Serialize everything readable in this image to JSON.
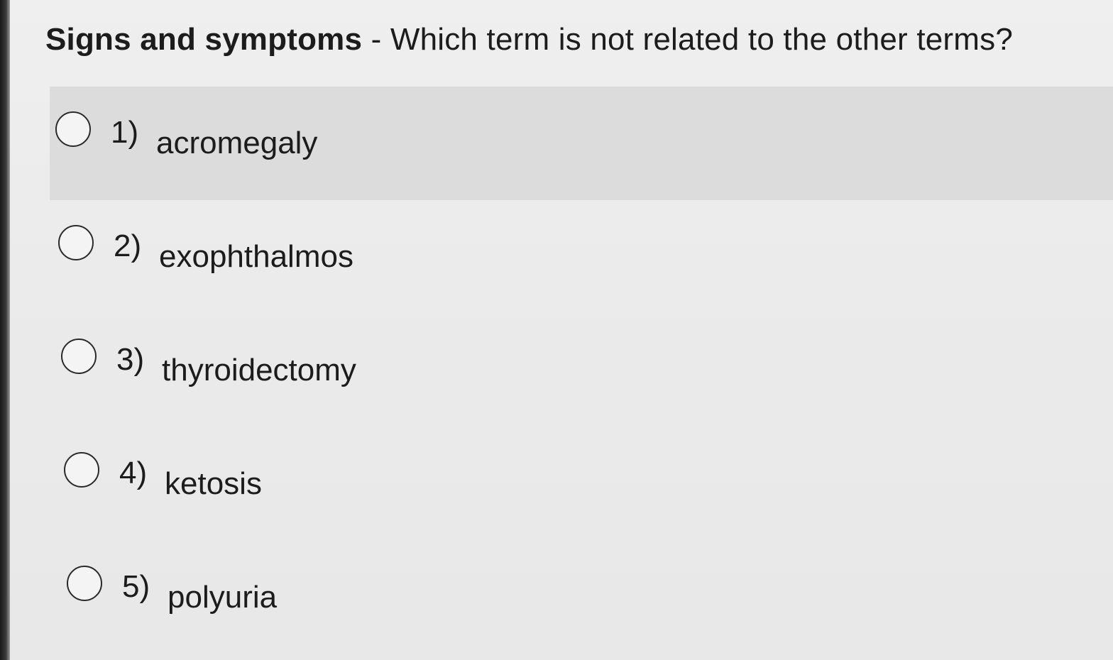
{
  "question": {
    "topic": "Signs and symptoms",
    "separator": " - ",
    "text": "Which term is not related to the other terms?"
  },
  "options": [
    {
      "number": "1)",
      "label": "acromegaly"
    },
    {
      "number": "2)",
      "label": "exophthalmos"
    },
    {
      "number": "3)",
      "label": "thyroidectomy"
    },
    {
      "number": "4)",
      "label": "ketosis"
    },
    {
      "number": "5)",
      "label": "polyuria"
    }
  ],
  "state": {
    "hovered_option": 1,
    "selected_option": null
  }
}
